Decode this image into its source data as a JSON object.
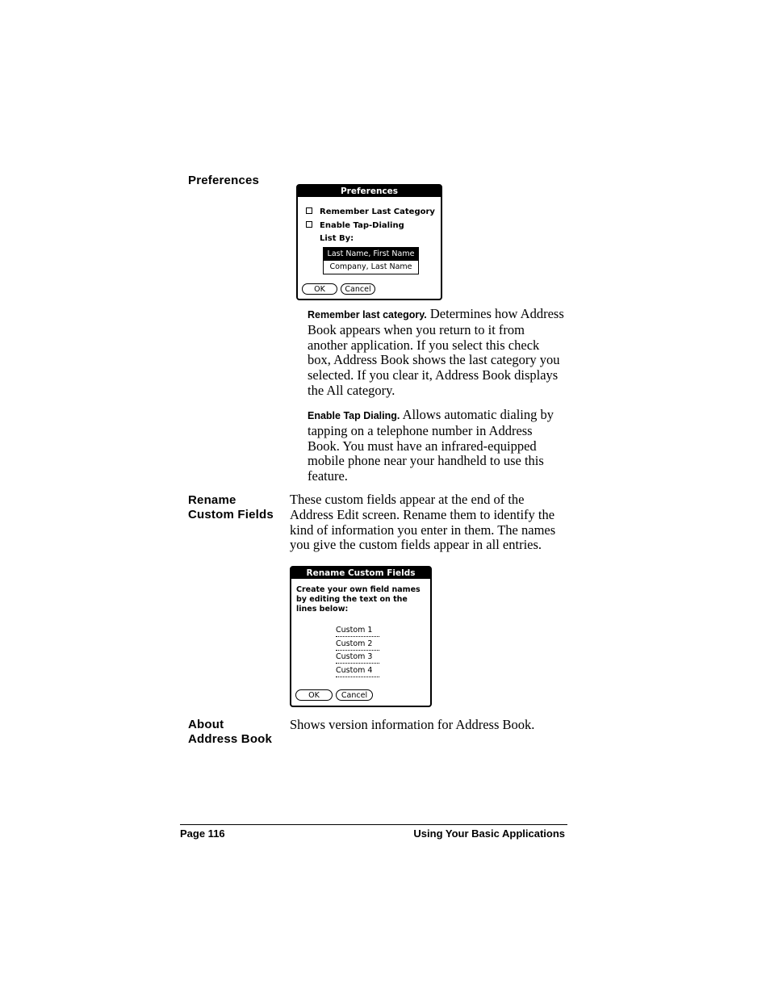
{
  "sections": {
    "preferences": {
      "term": "Preferences",
      "dialog": {
        "title": "Preferences",
        "checkboxes": [
          {
            "label": "Remember Last Category",
            "checked": false
          },
          {
            "label": "Enable Tap-Dialing",
            "checked": false
          }
        ],
        "list_by_label": "List By:",
        "list_options": [
          {
            "label": "Last Name, First Name",
            "selected": true
          },
          {
            "label": "Company, Last Name",
            "selected": false
          }
        ],
        "ok_label": "OK",
        "cancel_label": "Cancel"
      },
      "descriptions": [
        {
          "lead": "Remember last category.",
          "text": " Determines how Address Book appears when you return to it from another application. If you select this check box, Address Book shows the last category you selected. If you clear it, Address Book displays the All category."
        },
        {
          "lead": "Enable Tap Dialing.",
          "text": " Allows automatic dialing by tapping on a telephone number in Address Book. You must have an infrared-equipped mobile phone near your handheld to use this feature."
        }
      ]
    },
    "rename": {
      "term_line1": "Rename",
      "term_line2": "Custom Fields",
      "text": "These custom fields appear at the end of the Address Edit screen. Rename them to identify the kind of information you enter in them. The names you give the custom fields appear in all entries.",
      "dialog": {
        "title": "Rename Custom Fields",
        "instructions": "Create your own field names by editing the text on the lines below:",
        "fields": [
          "Custom 1",
          "Custom 2",
          "Custom 3",
          "Custom 4"
        ],
        "ok_label": "OK",
        "cancel_label": "Cancel"
      }
    },
    "about": {
      "term_line1": "About",
      "term_line2": "Address Book",
      "text": "Shows version information for Address Book."
    }
  },
  "footer": {
    "page": "Page 116",
    "chapter": "Using Your Basic Applications"
  }
}
